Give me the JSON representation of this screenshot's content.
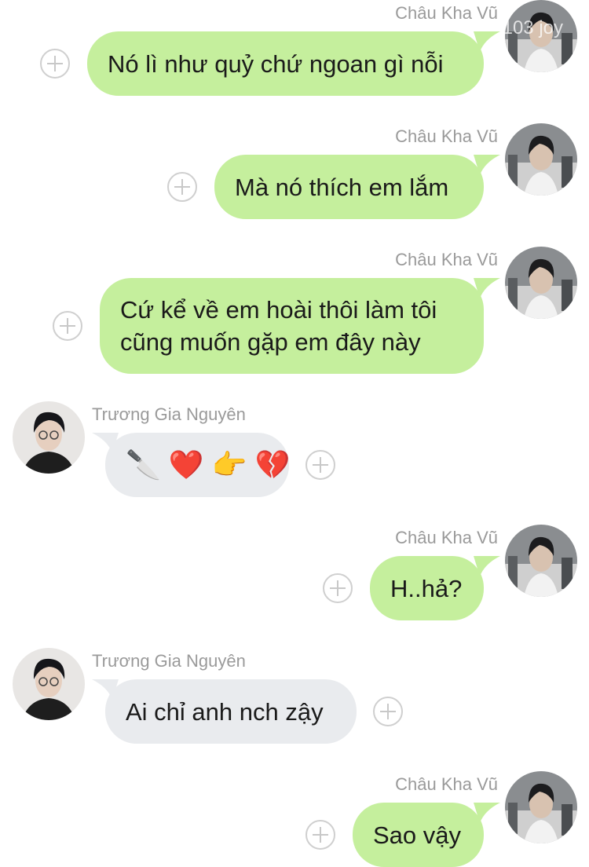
{
  "watermark": "103 joy",
  "messages": [
    {
      "sender": "Châu Kha Vũ",
      "text": "Nó lì như quỷ chứ ngoan gì nỗi"
    },
    {
      "sender": "Châu Kha Vũ",
      "text": "Mà nó thích em lắm"
    },
    {
      "sender": "Châu Kha Vũ",
      "line1": "Cứ kể về em hoài thôi làm tôi",
      "line2": "cũng muốn gặp em đây này"
    },
    {
      "sender": "Trương Gia Nguyên",
      "emojis": [
        "🔪",
        "❤️",
        "👉",
        "💔"
      ]
    },
    {
      "sender": "Châu Kha Vũ",
      "text": "H..hả?"
    },
    {
      "sender": "Trương Gia Nguyên",
      "text": "Ai chỉ anh nch zậy"
    },
    {
      "sender": "Châu Kha Vũ",
      "text": "Sao vậy"
    }
  ],
  "colors": {
    "outgoing_bubble": "#c5ef9d",
    "incoming_bubble": "#e9ebee",
    "sender_name": "#9a9a9a"
  }
}
